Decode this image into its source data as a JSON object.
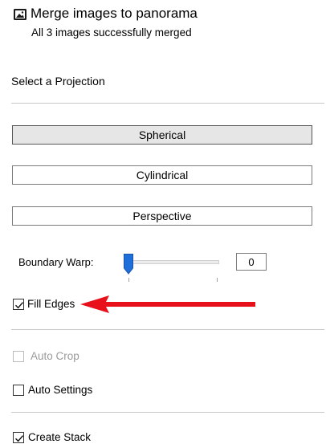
{
  "header": {
    "icon": "image-icon",
    "title": "Merge images to panorama",
    "subtitle": "All 3 images successfully merged"
  },
  "projection": {
    "heading": "Select a Projection",
    "options": [
      {
        "label": "Spherical",
        "selected": true
      },
      {
        "label": "Cylindrical",
        "selected": false
      },
      {
        "label": "Perspective",
        "selected": false
      }
    ]
  },
  "boundary_warp": {
    "label": "Boundary Warp:",
    "value": "0",
    "level": 0
  },
  "options": {
    "fill_edges": {
      "label": "Fill Edges",
      "checked": true,
      "enabled": true
    },
    "auto_crop": {
      "label": "Auto Crop",
      "checked": false,
      "enabled": false
    },
    "auto_settings": {
      "label": "Auto Settings",
      "checked": false,
      "enabled": true
    },
    "create_stack": {
      "label": "Create Stack",
      "checked": true,
      "enabled": true
    }
  },
  "annotation": {
    "icon": "red-arrow-icon",
    "color": "#e8101a"
  },
  "colors": {
    "accent": "#1e6fd9",
    "arrow": "#e8101a"
  }
}
